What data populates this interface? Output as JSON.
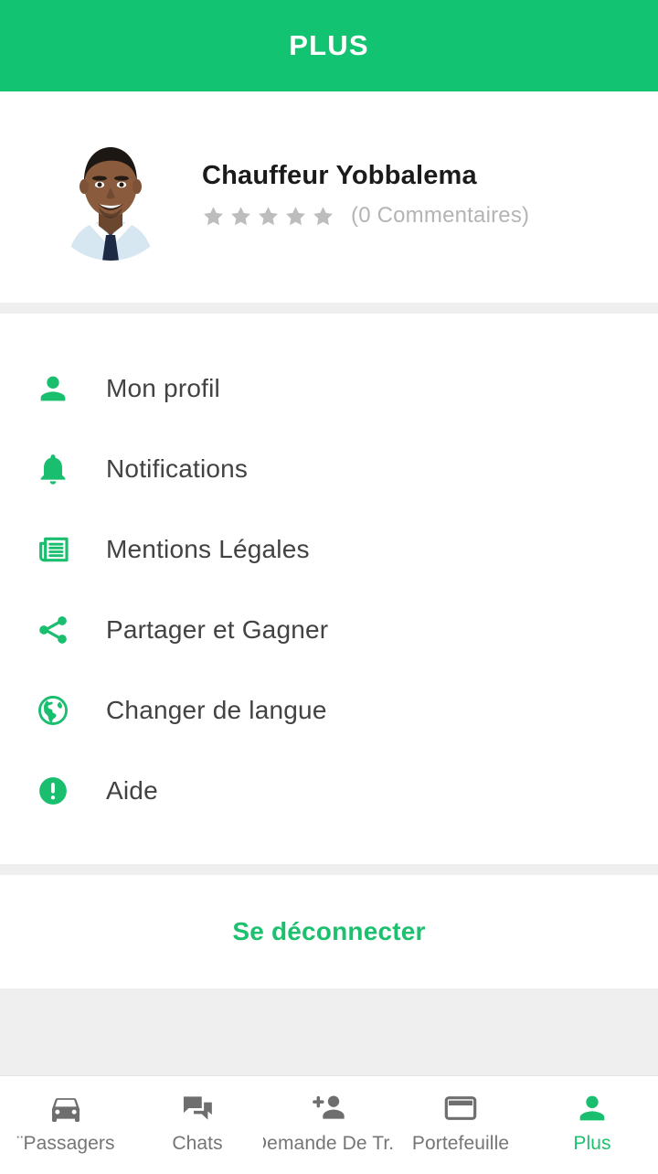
{
  "theme": {
    "brand_green": "#12c372",
    "accent_green": "#1cc06f",
    "label_gray": "#424242",
    "muted_gray": "#b4b4b4",
    "nav_inactive": "#757575",
    "page_bg": "#efefef",
    "card_bg": "#ffffff"
  },
  "header": {
    "title": "PLUS"
  },
  "profile": {
    "avatar_icon": "user-photo-avatar",
    "name": "Chauffeur Yobbalema",
    "rating": 5,
    "star_icon": "star-icon",
    "reviews_text": "(0 Commentaires)"
  },
  "menu": {
    "items": [
      {
        "icon": "person-icon",
        "label": "Mon profil"
      },
      {
        "icon": "bell-icon",
        "label": "Notifications"
      },
      {
        "icon": "newspaper-icon",
        "label": "Mentions Légales"
      },
      {
        "icon": "share-icon",
        "label": "Partager et Gagner"
      },
      {
        "icon": "globe-icon",
        "label": "Changer de langue"
      },
      {
        "icon": "exclamation-circle-icon",
        "label": "Aide"
      }
    ]
  },
  "logout": {
    "label": "Se déconnecter"
  },
  "bottom_nav": {
    "items": [
      {
        "icon": "car-icon",
        "label": "¨Passagers",
        "active": false
      },
      {
        "icon": "chat-icon",
        "label": "Chats",
        "active": false
      },
      {
        "icon": "add-person-icon",
        "label": "Demande De Tr...",
        "active": false
      },
      {
        "icon": "credit-card-icon",
        "label": "Portefeuille",
        "active": false
      },
      {
        "icon": "person-icon",
        "label": "Plus",
        "active": true
      }
    ]
  }
}
